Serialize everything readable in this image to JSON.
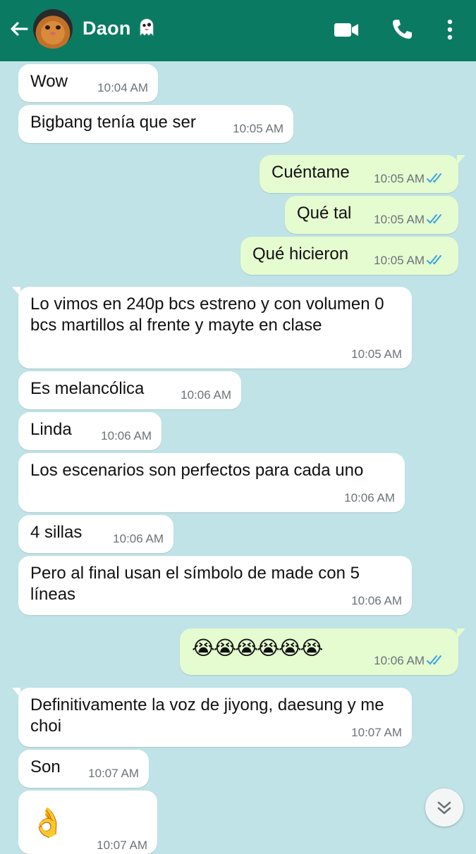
{
  "header": {
    "contact_name": "Daon",
    "contact_emoji": "ghost",
    "icons": [
      "back-arrow-icon",
      "video-call-icon",
      "phone-icon",
      "more-vert-icon"
    ],
    "bg_color": "#0b7a63"
  },
  "colors": {
    "chat_bg": "#bfe3e6",
    "incoming": "#ffffff",
    "outgoing": "#e5fbd0",
    "read_ticks": "#3aa3e3"
  },
  "messages": [
    {
      "dir": "in",
      "text": "Wow",
      "time": "10:04 AM"
    },
    {
      "dir": "in",
      "text": "Bigbang tenía que ser",
      "time": "10:05 AM"
    },
    {
      "dir": "out",
      "text": "Cuéntame",
      "time": "10:05 AM",
      "status": "read"
    },
    {
      "dir": "out",
      "text": "Qué tal",
      "time": "10:05 AM",
      "status": "read"
    },
    {
      "dir": "out",
      "text": "Qué hicieron",
      "time": "10:05 AM",
      "status": "read"
    },
    {
      "dir": "in",
      "text": "Lo vimos en 240p bcs estreno y con volumen 0 bcs martillos al frente y mayte en clase",
      "time": "10:05 AM"
    },
    {
      "dir": "in",
      "text": "Es melancólica",
      "time": "10:06 AM"
    },
    {
      "dir": "in",
      "text": "Linda",
      "time": "10:06 AM"
    },
    {
      "dir": "in",
      "text": "Los escenarios son perfectos para cada uno",
      "time": "10:06 AM"
    },
    {
      "dir": "in",
      "text": "4 sillas",
      "time": "10:06 AM"
    },
    {
      "dir": "in",
      "text": "Pero al final usan el símbolo de made con 5 líneas",
      "time": "10:06 AM"
    },
    {
      "dir": "out",
      "text": "😭😭😭😭😭😭",
      "time": "10:06 AM",
      "status": "read"
    },
    {
      "dir": "in",
      "text": "Definitivamente la voz de jiyong, daesung y me choi",
      "time": "10:07 AM"
    },
    {
      "dir": "in",
      "text": "Son",
      "time": "10:07 AM"
    },
    {
      "dir": "in",
      "text": "👌",
      "time": "10:07 AM"
    }
  ],
  "scroll_button": {
    "icon": "double-chevron-down-icon"
  }
}
